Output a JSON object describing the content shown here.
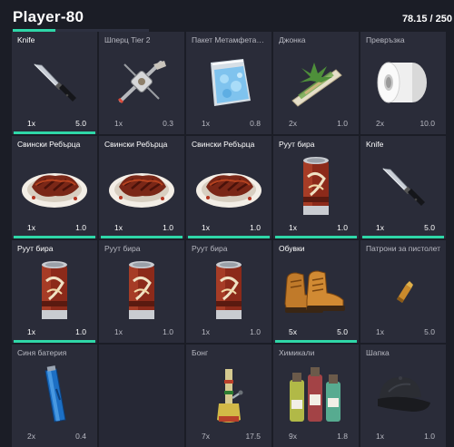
{
  "header": {
    "player_name": "Player-80",
    "weight_text": "78.15 / 250",
    "weight_ratio": 0.312
  },
  "slots": [
    {
      "name": "Knife",
      "qty": "1x",
      "weight": "5.0",
      "icon": "knife-icon",
      "durability": 1
    },
    {
      "name": "Шперц Tier 2",
      "qty": "1x",
      "weight": "0.3",
      "icon": "lockpick-icon",
      "durability": 0
    },
    {
      "name": "Пакет Метамфетамин",
      "qty": "1x",
      "weight": "0.8",
      "icon": "meth-bag-icon",
      "durability": 0
    },
    {
      "name": "Джонка",
      "qty": "2x",
      "weight": "1.0",
      "icon": "joint-icon",
      "durability": 0
    },
    {
      "name": "Превръзка",
      "qty": "2x",
      "weight": "10.0",
      "icon": "bandage-roll-icon",
      "durability": 0
    },
    {
      "name": "Свински Ребърца",
      "qty": "1x",
      "weight": "1.0",
      "icon": "ribs-plate-icon",
      "durability": 1
    },
    {
      "name": "Свински Ребърца",
      "qty": "1x",
      "weight": "1.0",
      "icon": "ribs-plate-icon",
      "durability": 1
    },
    {
      "name": "Свински Ребърца",
      "qty": "1x",
      "weight": "1.0",
      "icon": "ribs-plate-icon",
      "durability": 1
    },
    {
      "name": "Руут бира",
      "qty": "1x",
      "weight": "1.0",
      "icon": "root-beer-can-icon",
      "durability": 1
    },
    {
      "name": "Knife",
      "qty": "1x",
      "weight": "5.0",
      "icon": "knife-icon",
      "durability": 1
    },
    {
      "name": "Руут бира",
      "qty": "1x",
      "weight": "1.0",
      "icon": "root-beer-can-icon",
      "durability": 1
    },
    {
      "name": "Руут бира",
      "qty": "1x",
      "weight": "1.0",
      "icon": "root-beer-can-icon",
      "durability": 0
    },
    {
      "name": "Руут бира",
      "qty": "1x",
      "weight": "1.0",
      "icon": "root-beer-can-icon",
      "durability": 0
    },
    {
      "name": "Обувки",
      "qty": "5x",
      "weight": "5.0",
      "icon": "boots-icon",
      "durability": 1
    },
    {
      "name": "Патрони за пистолет",
      "qty": "1x",
      "weight": "5.0",
      "icon": "pistol-ammo-icon",
      "durability": 0
    },
    {
      "name": "Синя батерия",
      "qty": "2x",
      "weight": "0.4",
      "icon": "blue-battery-icon",
      "durability": 0
    },
    {
      "name": "",
      "qty": "",
      "weight": "",
      "icon": "",
      "durability": 0
    },
    {
      "name": "Бонг",
      "qty": "7x",
      "weight": "17.5",
      "icon": "bong-icon",
      "durability": 0
    },
    {
      "name": "Химикали",
      "qty": "9x",
      "weight": "1.8",
      "icon": "chemicals-icon",
      "durability": 0
    },
    {
      "name": "Шапка",
      "qty": "1x",
      "weight": "1.0",
      "icon": "cap-icon",
      "durability": 0
    }
  ]
}
